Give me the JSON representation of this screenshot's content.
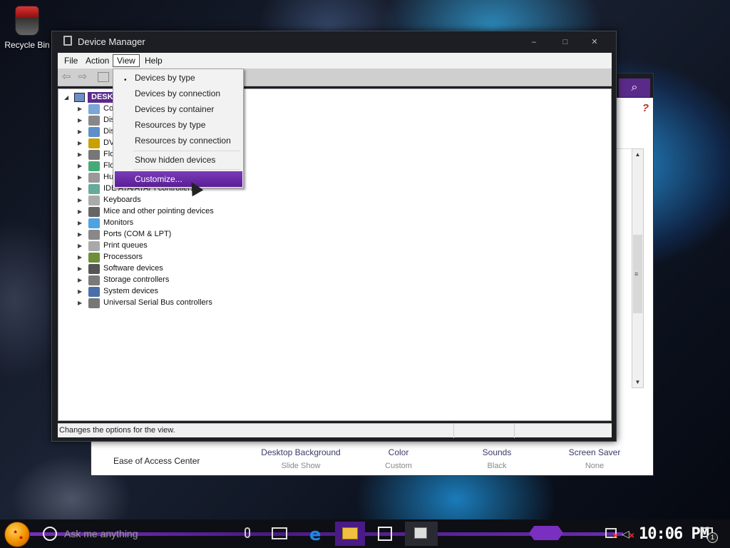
{
  "desktop": {
    "recycle_bin_label": "Recycle Bin"
  },
  "background_window": {
    "ease_of_access": "Ease of Access Center",
    "options": [
      {
        "title": "Desktop Background",
        "sub": "Slide Show"
      },
      {
        "title": "Color",
        "sub": "Custom"
      },
      {
        "title": "Sounds",
        "sub": "Black"
      },
      {
        "title": "Screen Saver",
        "sub": "None"
      }
    ],
    "help_glyph": "?",
    "search_glyph": "⌕"
  },
  "device_manager": {
    "title": "Device Manager",
    "window_buttons": {
      "minimize": "–",
      "maximize": "□",
      "close": "✕"
    },
    "menu": [
      "File",
      "Action",
      "View",
      "Help"
    ],
    "toolbar": {
      "back": "⇦",
      "forward": "⇨"
    },
    "root_label": "DESKTOP",
    "categories": [
      "Co",
      "Dis",
      "Dis",
      "DV",
      "Flo",
      "Flo",
      "Hu",
      "IDE ATA/ATAPI controllers",
      "Keyboards",
      "Mice and other pointing devices",
      "Monitors",
      "Ports (COM & LPT)",
      "Print queues",
      "Processors",
      "Software devices",
      "Storage controllers",
      "System devices",
      "Universal Serial Bus controllers"
    ],
    "status_text": "Changes the options for the view."
  },
  "view_menu": {
    "items": [
      "Devices by type",
      "Devices by connection",
      "Devices by container",
      "Resources by type",
      "Resources by connection",
      "Show hidden devices",
      "Customize..."
    ],
    "selected_bullet": "•"
  },
  "taskbar": {
    "search_placeholder": "Ask me anything",
    "edge_glyph": "e",
    "clock": "10:06 PM",
    "notification_count": "1",
    "tray_x": "✕",
    "volume_glyph": "◁"
  },
  "colors": {
    "accent": "#5b2a8d",
    "menu_highlight": "#6a2bb0",
    "edge_blue": "#1e88e5"
  }
}
